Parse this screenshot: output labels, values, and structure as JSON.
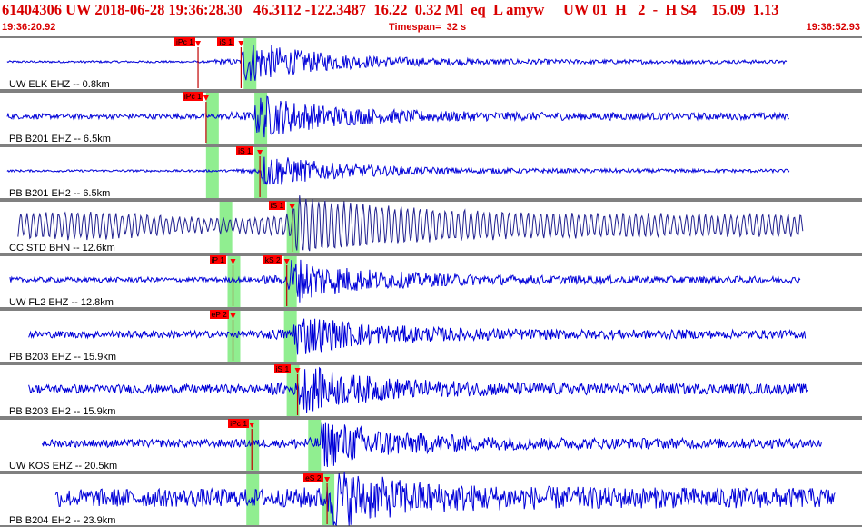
{
  "header": {
    "title": "61404306 UW 2018-06-28 19:36:28.30   46.3112 -122.3487  16.22  0.32 Ml  eq  L amyw     UW 01  H   2  -  H S4    15.09  1.13",
    "start_time": "19:36:20.92",
    "timespan": "Timespan=  32 s",
    "end_time": "19:36:52.93"
  },
  "colors": {
    "header_text": "#d80000",
    "trace": "#0000d8",
    "trace_alt": "#202090",
    "pick_box": "#ff0000",
    "pick_line": "#c00000",
    "window": "#90ee90"
  },
  "channels": [
    {
      "label": "UW ELK EHZ -- 0.8km",
      "picks": [
        {
          "text": "iPc 1",
          "t": 7.3
        },
        {
          "text": "iS 1",
          "t": 8.9
        }
      ],
      "windows": [
        9.2
      ],
      "trace": {
        "start": 0.2,
        "end": 29.2,
        "noise": 0.05,
        "event": 8.9,
        "amp": 0.95
      }
    },
    {
      "label": "PB B201 EHZ -- 6.5km",
      "picks": [
        {
          "text": "iPc 1",
          "t": 7.6
        }
      ],
      "windows": [
        7.8,
        9.6
      ],
      "trace": {
        "start": 0.2,
        "end": 29.3,
        "noise": 0.12,
        "event": 9.4,
        "amp": 0.9
      }
    },
    {
      "label": "PB B201 EH2 -- 6.5km",
      "picks": [
        {
          "text": "iS 1",
          "t": 9.6
        }
      ],
      "windows": [
        7.8,
        9.6
      ],
      "trace": {
        "start": 0.2,
        "end": 29.3,
        "noise": 0.05,
        "event": 9.6,
        "amp": 0.75
      }
    },
    {
      "label": "CC STD BHN -- 12.6km",
      "picks": [
        {
          "text": "iS 1",
          "t": 10.8
        }
      ],
      "windows": [
        8.3,
        10.8
      ],
      "trace": {
        "start": 0.6,
        "end": 29.8,
        "noise": 0.45,
        "event": 10.8,
        "amp": 0.9,
        "style": "bhn"
      }
    },
    {
      "label": "UW FL2 EHZ -- 12.8km",
      "picks": [
        {
          "text": "iP 1",
          "t": 8.6
        },
        {
          "text": "kS 2",
          "t": 10.6
        }
      ],
      "windows": [
        8.6,
        10.7
      ],
      "trace": {
        "start": 0.3,
        "end": 29.7,
        "noise": 0.12,
        "event": 10.6,
        "amp": 0.95
      }
    },
    {
      "label": "PB B203 EHZ -- 15.9km",
      "picks": [
        {
          "text": "eP 2",
          "t": 8.6
        }
      ],
      "windows": [
        8.6,
        10.7
      ],
      "trace": {
        "start": 1.0,
        "end": 29.9,
        "noise": 0.16,
        "event": 10.8,
        "amp": 0.85
      }
    },
    {
      "label": "PB B203 EH2 -- 15.9km",
      "picks": [
        {
          "text": "iS 1",
          "t": 11.0
        }
      ],
      "windows": [
        10.8
      ],
      "trace": {
        "start": 1.0,
        "end": 30.0,
        "noise": 0.2,
        "event": 11.0,
        "amp": 0.9
      }
    },
    {
      "label": "UW KOS EHZ -- 20.5km",
      "picks": [
        {
          "text": "iPc 1",
          "t": 9.3
        }
      ],
      "windows": [
        9.3,
        11.6
      ],
      "trace": {
        "start": 1.5,
        "end": 30.5,
        "noise": 0.18,
        "event": 11.8,
        "amp": 0.95
      }
    },
    {
      "label": "PB B204 EH2 -- 23.9km",
      "picks": [
        {
          "text": "eS 2",
          "t": 12.1
        }
      ],
      "windows": [
        9.3,
        12.1
      ],
      "trace": {
        "start": 2.0,
        "end": 31.0,
        "noise": 0.42,
        "event": 12.1,
        "amp": 1.0
      }
    }
  ]
}
